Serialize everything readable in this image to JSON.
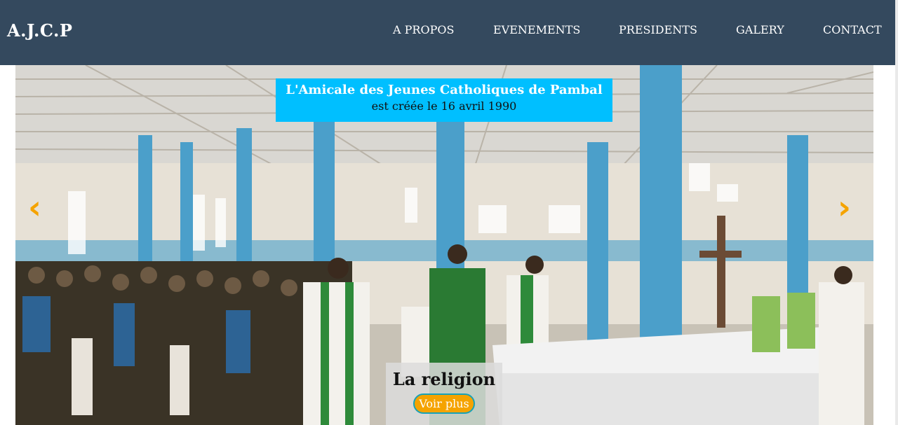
{
  "navbar": {
    "brand": "A.J.C.P",
    "links": [
      "A PROPOS",
      "EVENEMENTS",
      "PRESIDENTS",
      "GALERY",
      "CONTACT"
    ]
  },
  "hero": {
    "caption_title": "L'Amicale des Jeunes Catholiques de Pambal",
    "caption_sub": "est créée le 16 avril 1990",
    "slide_title": "La religion",
    "slide_button": "Voir plus",
    "prev_icon": "chevron-left-icon",
    "next_icon": "chevron-right-icon"
  },
  "colors": {
    "navbar": "#34495e",
    "caption_bg": "#00bfff",
    "accent": "#f5a300",
    "button_border": "#17a2b8"
  }
}
